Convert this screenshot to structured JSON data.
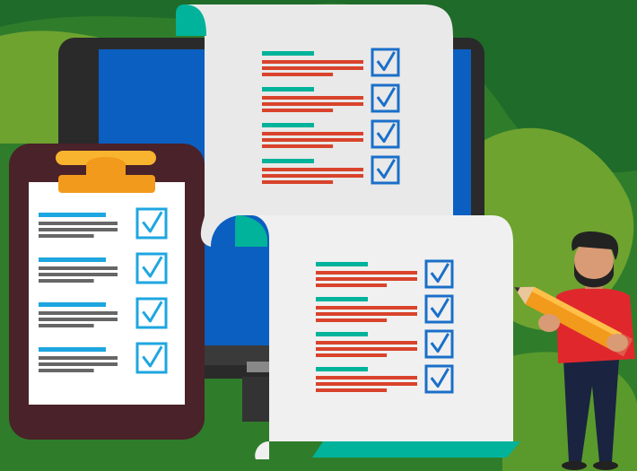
{
  "scene": {
    "kind": "illustration",
    "subject": "checklist",
    "colors": {
      "background_dark": "#1f6b2a",
      "background_mid": "#3d8a2e",
      "background_light": "#7fb030",
      "monitor_frame": "#2a2a2a",
      "monitor_screen": "#0b5fc0",
      "clipboard_board": "#4a2229",
      "clipboard_clip": "#f4a32a",
      "paper": "#f0f0f0",
      "teal_accent": "#00b39a",
      "red_line": "#d9432b",
      "blue_line": "#1ea6e0",
      "gray_line": "#666666",
      "checkbox_blue": "#1a6fc9",
      "pencil_orange": "#f29a1b",
      "shirt_red": "#e0282c",
      "pants_navy": "#1a2340"
    },
    "icons": [
      "check-icon",
      "clipboard-icon",
      "pencil-icon",
      "monitor-icon",
      "person-icon"
    ],
    "checklists": [
      {
        "name": "clipboard-checklist",
        "items_checked": [
          true,
          true,
          true,
          true
        ]
      },
      {
        "name": "top-paper-checklist",
        "items_checked": [
          true,
          true,
          true,
          true
        ]
      },
      {
        "name": "bottom-paper-checklist",
        "items_checked": [
          true,
          true,
          true,
          true
        ]
      }
    ]
  }
}
